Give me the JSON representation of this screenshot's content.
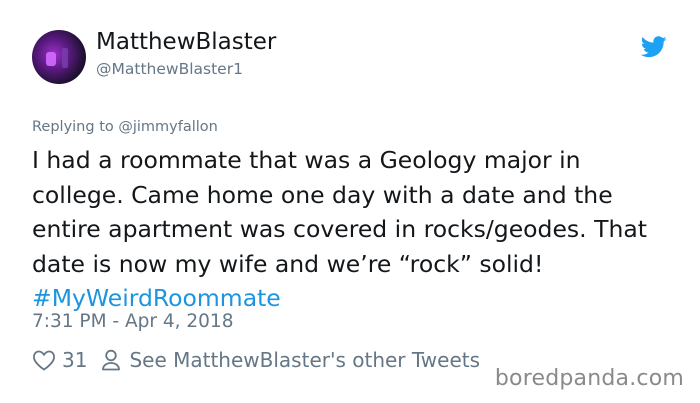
{
  "author": {
    "display_name": "MatthewBlaster",
    "handle": "@MatthewBlaster1"
  },
  "reply": {
    "prefix": "Replying to ",
    "mention": "@jimmyfallon"
  },
  "tweet": {
    "lines": [
      "I had a roommate that was a Geology major in",
      "college. Came home one day with a date and the",
      "entire apartment was covered in rocks/geodes. That",
      "date is now my wife and we’re “rock” solid!"
    ],
    "hashtag": "#MyWeirdRoommate"
  },
  "timestamp": "7:31 PM - Apr 4, 2018",
  "actions": {
    "like_count": "31",
    "other_tweets_label": "See MatthewBlaster's other Tweets"
  },
  "watermark": "boredpanda.com",
  "colors": {
    "brand": "#1da1f2",
    "hashtag": "#1b95e0",
    "secondary_text": "#657786"
  },
  "icons": [
    "twitter-bird-icon",
    "heart-icon",
    "person-icon"
  ]
}
